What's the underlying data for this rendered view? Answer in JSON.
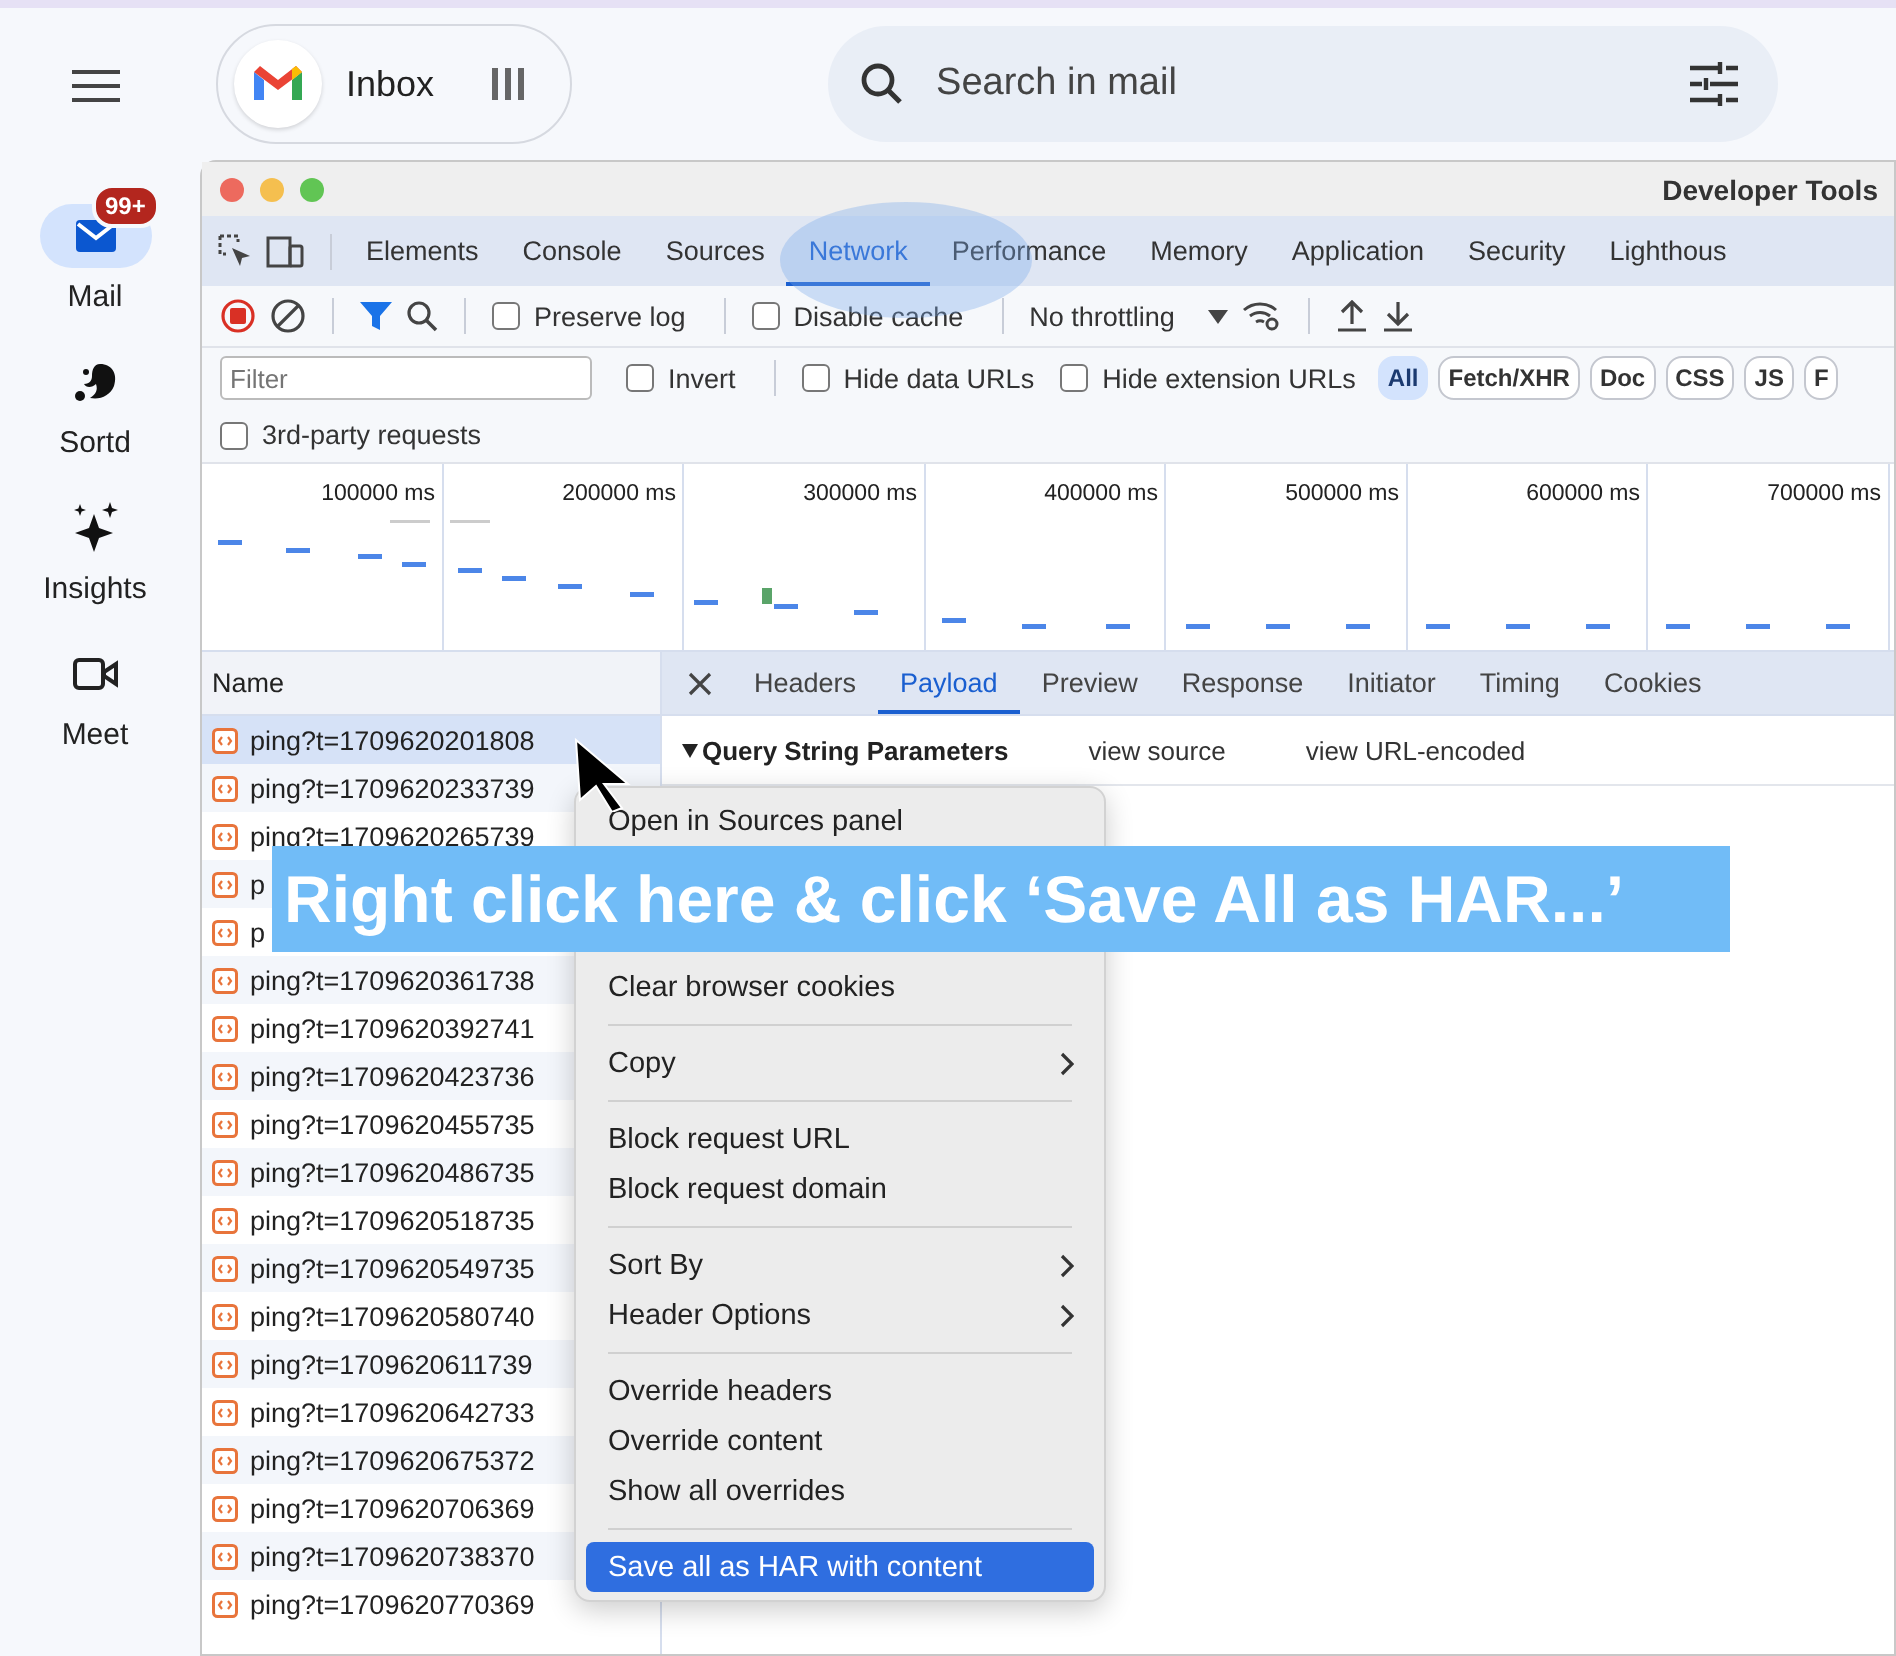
{
  "header": {
    "inbox_label": "Inbox",
    "search_placeholder": "Search in mail"
  },
  "rail": [
    {
      "label": "Mail",
      "kind": "mail",
      "selected": true,
      "badge": "99+"
    },
    {
      "label": "Sortd",
      "kind": "sortd",
      "selected": false
    },
    {
      "label": "Insights",
      "kind": "insights",
      "selected": false
    },
    {
      "label": "Meet",
      "kind": "meet",
      "selected": false
    }
  ],
  "devtools": {
    "title": "Developer Tools",
    "tabs": [
      {
        "label": "Elements",
        "selected": false
      },
      {
        "label": "Console",
        "selected": false
      },
      {
        "label": "Sources",
        "selected": false
      },
      {
        "label": "Network",
        "selected": true
      },
      {
        "label": "Performance",
        "selected": false
      },
      {
        "label": "Memory",
        "selected": false
      },
      {
        "label": "Application",
        "selected": false
      },
      {
        "label": "Security",
        "selected": false
      },
      {
        "label": "Lighthous",
        "selected": false
      }
    ],
    "toolbar": {
      "checks": [
        {
          "label": "Preserve log",
          "checked": false
        },
        {
          "label": "Disable cache",
          "checked": false
        }
      ],
      "throttling": "No throttling"
    },
    "filter": {
      "placeholder": "Filter",
      "options": [
        {
          "label": "Invert",
          "checked": false
        },
        {
          "label": "Hide data URLs",
          "checked": false
        },
        {
          "label": "Hide extension URLs",
          "checked": false
        }
      ],
      "types": [
        {
          "label": "All",
          "selected": true
        },
        {
          "label": "Fetch/XHR",
          "selected": false
        },
        {
          "label": "Doc",
          "selected": false
        },
        {
          "label": "CSS",
          "selected": false
        },
        {
          "label": "JS",
          "selected": false
        },
        {
          "label": "F",
          "selected": false
        }
      ]
    },
    "third_party": {
      "label": "3rd-party requests",
      "checked": false
    },
    "timeline_ticks": [
      "100000 ms",
      "200000 ms",
      "300000 ms",
      "400000 ms",
      "500000 ms",
      "600000 ms",
      "700000 ms"
    ],
    "requests": {
      "column": "Name",
      "rows": [
        {
          "name": "ping?t=1709620201808",
          "selected": true
        },
        {
          "name": "ping?t=1709620233739",
          "selected": false
        },
        {
          "name": "ping?t=1709620265739",
          "selected": false
        },
        {
          "name": "p",
          "selected": false
        },
        {
          "name": "p",
          "selected": false
        },
        {
          "name": "ping?t=1709620361738",
          "selected": false
        },
        {
          "name": "ping?t=1709620392741",
          "selected": false
        },
        {
          "name": "ping?t=1709620423736",
          "selected": false
        },
        {
          "name": "ping?t=1709620455735",
          "selected": false
        },
        {
          "name": "ping?t=1709620486735",
          "selected": false
        },
        {
          "name": "ping?t=1709620518735",
          "selected": false
        },
        {
          "name": "ping?t=1709620549735",
          "selected": false
        },
        {
          "name": "ping?t=1709620580740",
          "selected": false
        },
        {
          "name": "ping?t=1709620611739",
          "selected": false
        },
        {
          "name": "ping?t=1709620642733",
          "selected": false
        },
        {
          "name": "ping?t=1709620675372",
          "selected": false
        },
        {
          "name": "ping?t=1709620706369",
          "selected": false
        },
        {
          "name": "ping?t=1709620738370",
          "selected": false
        },
        {
          "name": "ping?t=1709620770369",
          "selected": false
        }
      ]
    },
    "detail": {
      "tabs": [
        {
          "label": "Headers",
          "selected": false
        },
        {
          "label": "Payload",
          "selected": true
        },
        {
          "label": "Preview",
          "selected": false
        },
        {
          "label": "Response",
          "selected": false
        },
        {
          "label": "Initiator",
          "selected": false
        },
        {
          "label": "Timing",
          "selected": false
        },
        {
          "label": "Cookies",
          "selected": false
        }
      ],
      "section": "Query String Parameters",
      "links": [
        "view source",
        "view URL-encoded"
      ]
    }
  },
  "context_menu": {
    "groups": [
      [
        {
          "label": "Open in Sources panel",
          "submenu": false,
          "selected": false
        }
      ],
      [
        {
          "label": "Clear browser cookies",
          "submenu": false,
          "selected": false
        }
      ],
      [
        {
          "label": "Copy",
          "submenu": true,
          "selected": false
        }
      ],
      [
        {
          "label": "Block request URL",
          "submenu": false,
          "selected": false
        },
        {
          "label": "Block request domain",
          "submenu": false,
          "selected": false
        }
      ],
      [
        {
          "label": "Sort By",
          "submenu": true,
          "selected": false
        },
        {
          "label": "Header Options",
          "submenu": true,
          "selected": false
        }
      ],
      [
        {
          "label": "Override headers",
          "submenu": false,
          "selected": false
        },
        {
          "label": "Override content",
          "submenu": false,
          "selected": false
        },
        {
          "label": "Show all overrides",
          "submenu": false,
          "selected": false
        }
      ],
      [
        {
          "label": "Save all as HAR with content",
          "submenu": false,
          "selected": true
        }
      ]
    ]
  },
  "annotation": "Right click here & click ‘Save All as HAR...’"
}
